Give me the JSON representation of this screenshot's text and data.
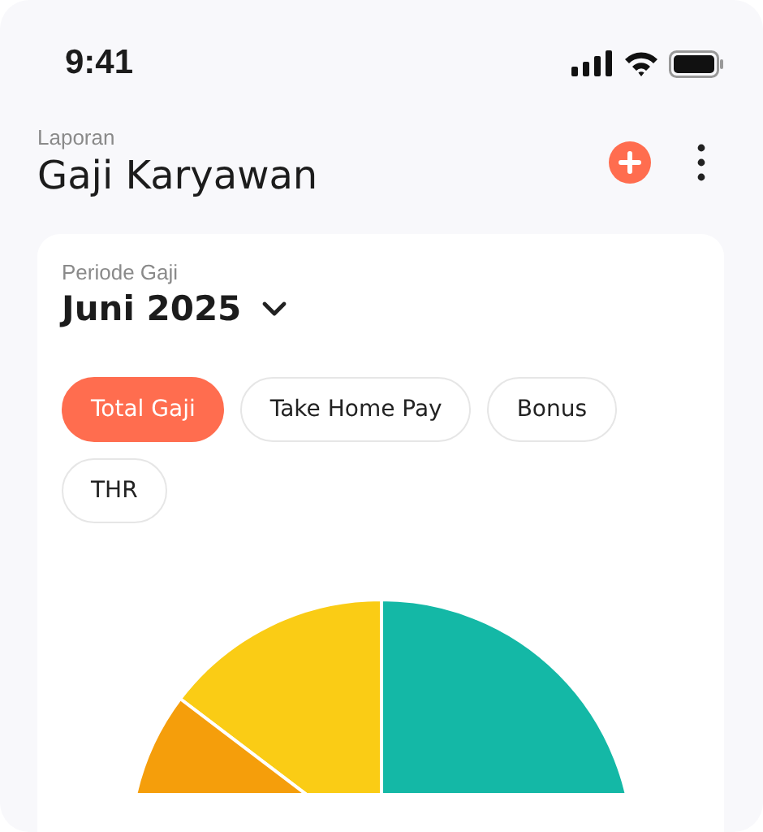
{
  "status_bar": {
    "time": "9:41"
  },
  "header": {
    "subtitle": "Laporan",
    "title": "Gaji Karyawan"
  },
  "period": {
    "label": "Periode Gaji",
    "value": "Juni 2025"
  },
  "filters": [
    {
      "label": "Total Gaji",
      "selected": true
    },
    {
      "label": "Take Home Pay",
      "selected": false
    },
    {
      "label": "Bonus",
      "selected": false
    },
    {
      "label": "THR",
      "selected": false
    }
  ]
}
